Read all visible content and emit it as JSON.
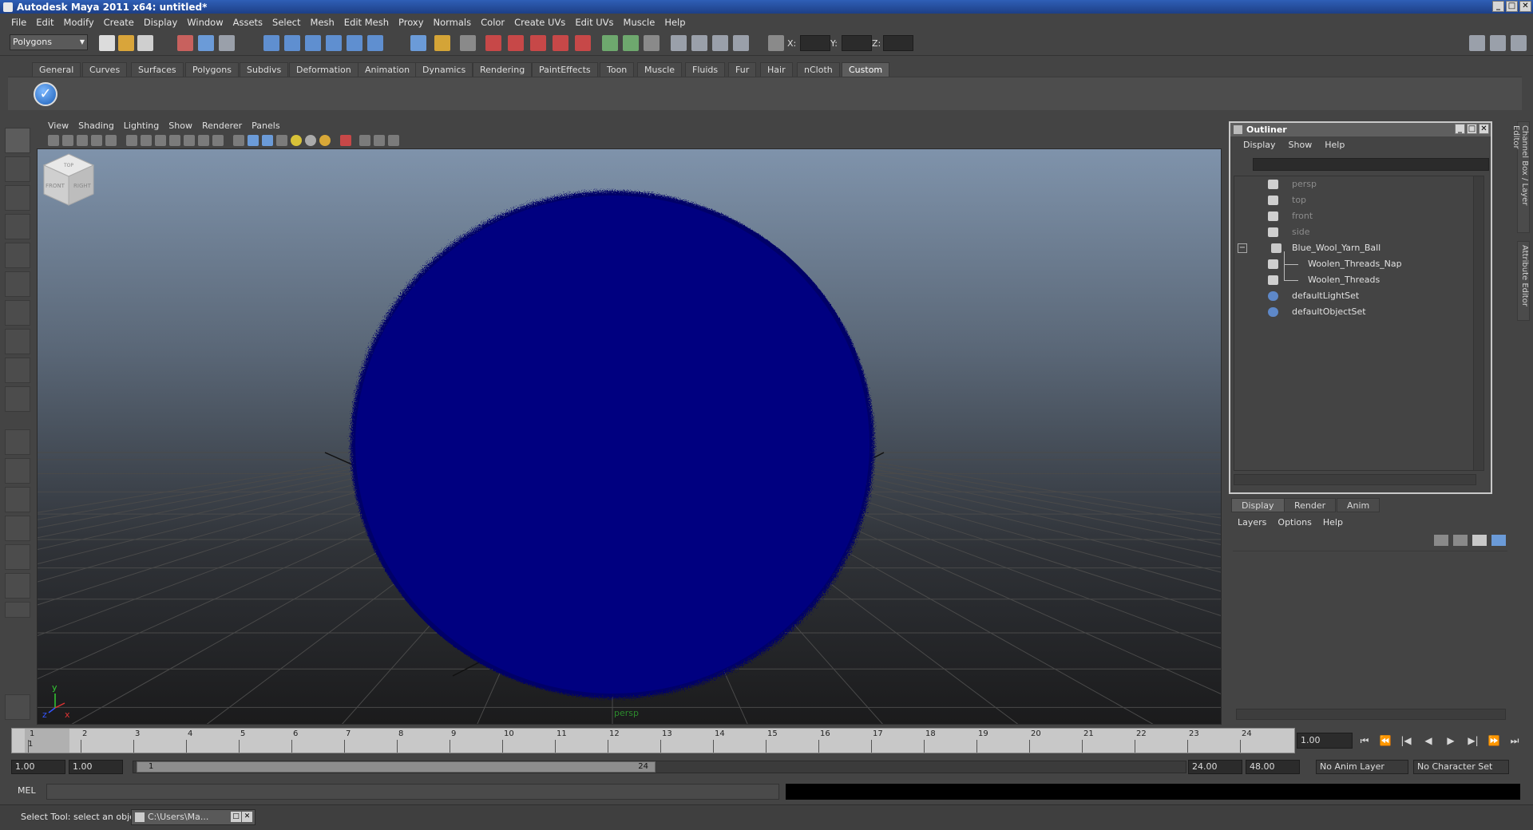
{
  "window": {
    "title": "Autodesk Maya 2011 x64: untitled*",
    "controls": [
      "_",
      "□",
      "✕"
    ]
  },
  "menubar": {
    "items": [
      "File",
      "Edit",
      "Modify",
      "Create",
      "Display",
      "Window",
      "Assets",
      "Select",
      "Mesh",
      "Edit Mesh",
      "Proxy",
      "Normals",
      "Color",
      "Create UVs",
      "Edit UVs",
      "Muscle",
      "Help"
    ]
  },
  "statusline": {
    "mode": "Polygons",
    "coord_labels": [
      "X:",
      "Y:",
      "Z:"
    ]
  },
  "shelf": {
    "tabs": [
      "General",
      "Curves",
      "Surfaces",
      "Polygons",
      "Subdivs",
      "Deformation",
      "Animation",
      "Dynamics",
      "Rendering",
      "PaintEffects",
      "Toon",
      "Muscle",
      "Fluids",
      "Fur",
      "Hair",
      "nCloth",
      "Custom"
    ],
    "active_tab": "Custom"
  },
  "viewport": {
    "menu": [
      "View",
      "Shading",
      "Lighting",
      "Show",
      "Renderer",
      "Panels"
    ],
    "camera_name": "persp",
    "viewcube_faces": [
      "FRONT",
      "RIGHT",
      "TOP"
    ],
    "axis_labels": [
      "y",
      "z",
      "x"
    ],
    "object_color": "#000080"
  },
  "outliner": {
    "title": "Outliner",
    "menu": [
      "Display",
      "Show",
      "Help"
    ],
    "items": [
      {
        "label": "persp",
        "dim": true,
        "indent": 0
      },
      {
        "label": "top",
        "dim": true,
        "indent": 0
      },
      {
        "label": "front",
        "dim": true,
        "indent": 0
      },
      {
        "label": "side",
        "dim": true,
        "indent": 0
      },
      {
        "label": "Blue_Wool_Yarn_Ball",
        "dim": false,
        "indent": 0,
        "expanded": true
      },
      {
        "label": "Woolen_Threads_Nap",
        "dim": false,
        "indent": 1
      },
      {
        "label": "Woolen_Threads",
        "dim": false,
        "indent": 1
      },
      {
        "label": "defaultLightSet",
        "dim": false,
        "indent": 0
      },
      {
        "label": "defaultObjectSet",
        "dim": false,
        "indent": 0
      }
    ],
    "expand_glyph": "−"
  },
  "sidetabs": [
    "Channel Box / Layer Editor",
    "Attribute Editor"
  ],
  "layer_editor": {
    "tabs": [
      "Display",
      "Render",
      "Anim"
    ],
    "active_tab": "Display",
    "menu": [
      "Layers",
      "Options",
      "Help"
    ]
  },
  "timeslider": {
    "frames": [
      "1",
      "2",
      "3",
      "4",
      "5",
      "6",
      "7",
      "8",
      "9",
      "10",
      "11",
      "12",
      "13",
      "14",
      "15",
      "16",
      "17",
      "18",
      "19",
      "20",
      "21",
      "22",
      "23",
      "24"
    ],
    "current_frame_label": "1",
    "current_time": "1.00",
    "playback_buttons": [
      "⏮",
      "⏪",
      "|◀",
      "◀",
      "▶",
      "▶|",
      "⏩",
      "⏭"
    ]
  },
  "rangeslider": {
    "start_time": "1.00",
    "playback_start": "1.00",
    "range_start_label": "1",
    "range_end_label": "24",
    "playback_end": "24.00",
    "end_time": "48.00",
    "anim_layer": "No Anim Layer",
    "character_set": "No Character Set"
  },
  "commandline": {
    "tag": "MEL"
  },
  "helpline": {
    "text": "Select Tool: select an object",
    "task_label": "C:\\Users\\Ma..."
  }
}
